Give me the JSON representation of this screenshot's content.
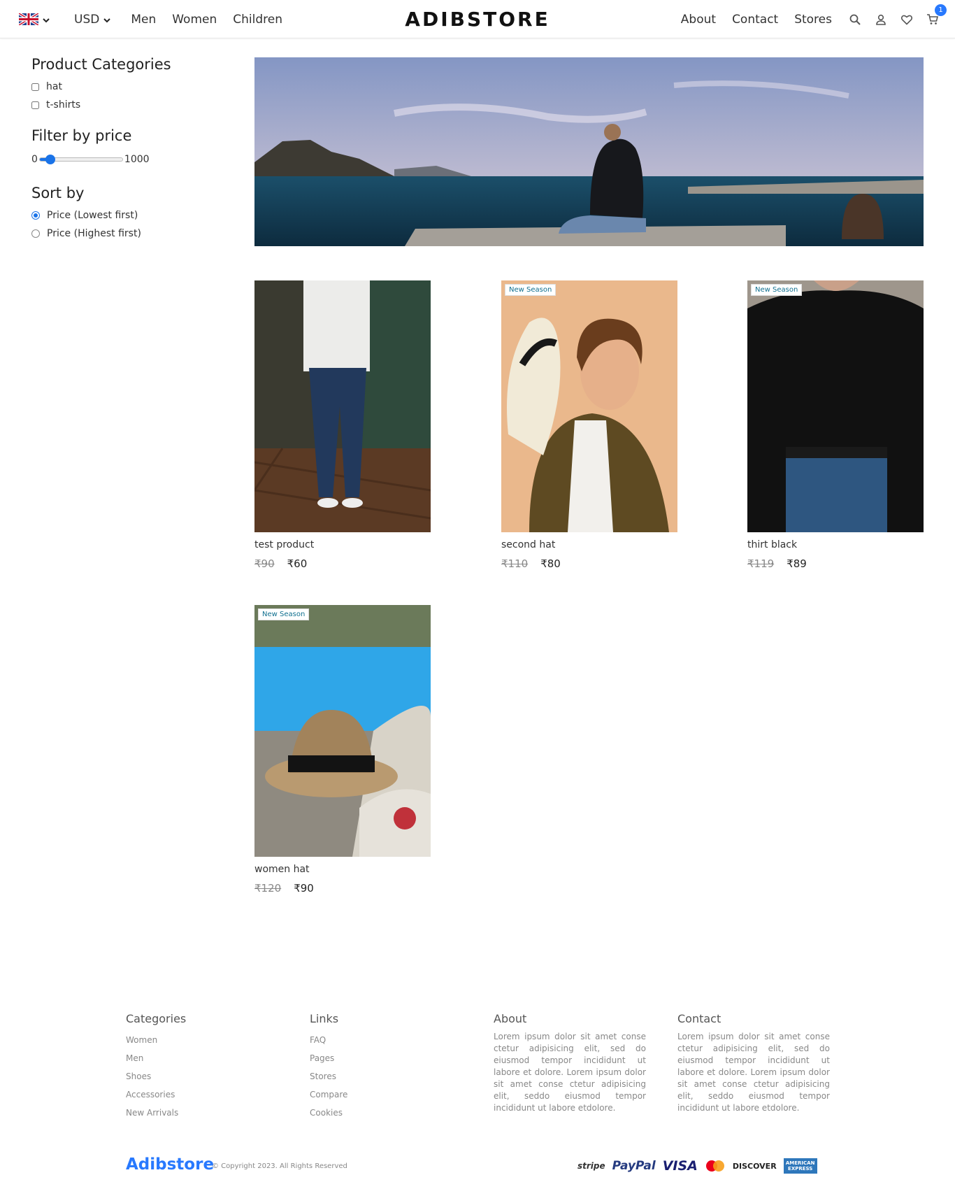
{
  "nav": {
    "currency": "USD",
    "links_left": [
      "Men",
      "Women",
      "Children"
    ],
    "logo": "ADIBSTORE",
    "links_right": [
      "About",
      "Contact",
      "Stores"
    ],
    "cart_count": "1"
  },
  "sidebar": {
    "categories_heading": "Product Categories",
    "categories": [
      "hat",
      "t-shirts"
    ],
    "price_heading": "Filter by price",
    "price_min": "0",
    "price_max": "1000",
    "price_value": 0,
    "sort_heading": "Sort by",
    "sort_options": [
      "Price (Lowest first)",
      "Price (Highest first)"
    ],
    "sort_selected": 0
  },
  "products": [
    {
      "title": "test product",
      "old_price": "₹90",
      "price": "₹60",
      "badge": ""
    },
    {
      "title": "second hat",
      "old_price": "₹110",
      "price": "₹80",
      "badge": "New Season"
    },
    {
      "title": "thirt black",
      "old_price": "₹119",
      "price": "₹89",
      "badge": "New Season"
    },
    {
      "title": "women hat",
      "old_price": "₹120",
      "price": "₹90",
      "badge": "New Season"
    }
  ],
  "footer": {
    "categories_heading": "Categories",
    "categories": [
      "Women",
      "Men",
      "Shoes",
      "Accessories",
      "New Arrivals"
    ],
    "links_heading": "Links",
    "links": [
      "FAQ",
      "Pages",
      "Stores",
      "Compare",
      "Cookies"
    ],
    "about_heading": "About",
    "about_text": "Lorem ipsum dolor sit amet conse ctetur adipisicing elit, sed do eiusmod tempor incididunt ut labore et dolore. Lorem ipsum dolor sit amet conse ctetur adipisicing elit, seddo eiusmod tempor incididunt ut labore etdolore.",
    "contact_heading": "Contact",
    "contact_text": "Lorem ipsum dolor sit amet conse ctetur adipisicing elit, sed do eiusmod tempor incididunt ut labore et dolore. Lorem ipsum dolor sit amet conse ctetur adipisicing elit, seddo eiusmod tempor incididunt ut labore etdolore.",
    "brand": "Adibstore",
    "copyright": "© Copyright 2023. All Rights Reserved",
    "payments": [
      "stripe",
      "PayPal",
      "VISA",
      "MasterCard",
      "DISCOVER",
      "AMERICAN EXPRESS"
    ]
  },
  "colors": {
    "accent": "#2879fe",
    "radio": "#1a73e8",
    "badge_text": "#0f6f8f"
  }
}
